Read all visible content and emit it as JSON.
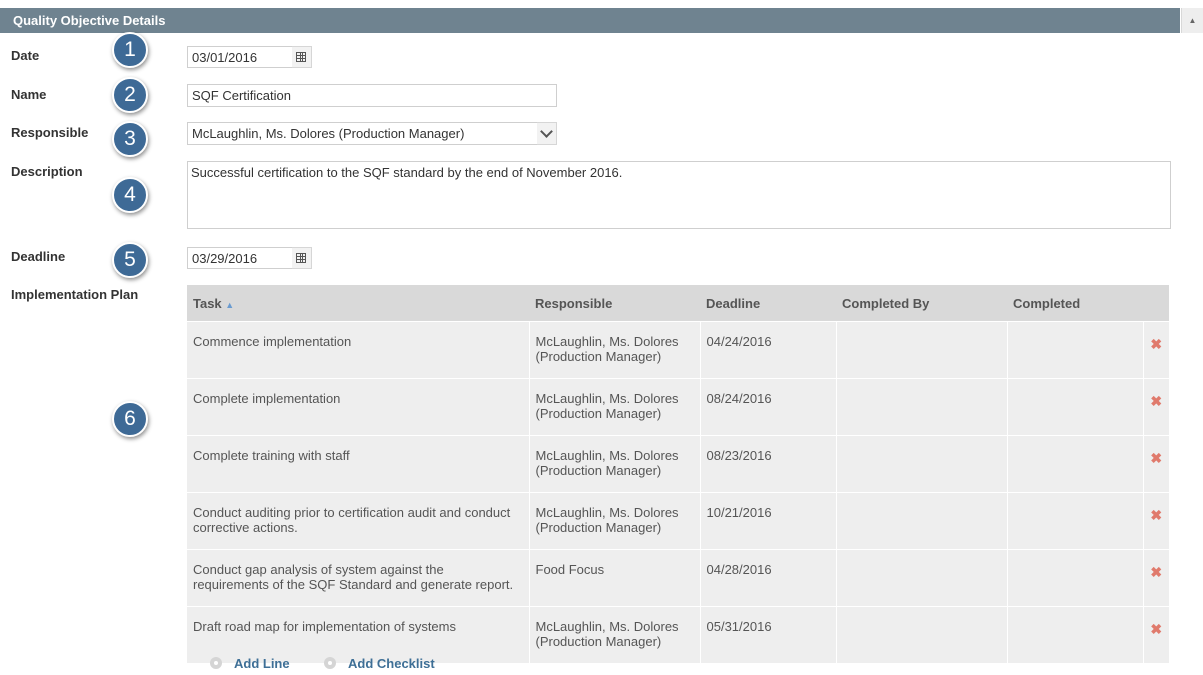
{
  "panel": {
    "title": "Quality Objective Details",
    "collapse_glyph": "▲"
  },
  "badges": [
    "1",
    "2",
    "3",
    "4",
    "5",
    "6"
  ],
  "form": {
    "date": {
      "label": "Date",
      "value": "03/01/2016"
    },
    "name": {
      "label": "Name",
      "value": "SQF Certification"
    },
    "responsible": {
      "label": "Responsible",
      "value": "McLaughlin, Ms. Dolores (Production Manager)"
    },
    "description": {
      "label": "Description",
      "value": "Successful certification to the SQF standard by the end of November 2016."
    },
    "deadline": {
      "label": "Deadline",
      "value": "03/29/2016"
    },
    "plan_label": "Implementation Plan"
  },
  "table": {
    "headers": [
      "Task",
      "Responsible",
      "Deadline",
      "Completed By",
      "Completed"
    ],
    "sort_glyph": "▲",
    "delete_glyph": "✖",
    "rows": [
      {
        "task": "Commence implementation",
        "responsible": "McLaughlin, Ms. Dolores (Production Manager)",
        "deadline": "04/24/2016",
        "completed_by": "",
        "completed": ""
      },
      {
        "task": "Complete implementation",
        "responsible": "McLaughlin, Ms. Dolores (Production Manager)",
        "deadline": "08/24/2016",
        "completed_by": "",
        "completed": ""
      },
      {
        "task": "Complete training with staff",
        "responsible": "McLaughlin, Ms. Dolores (Production Manager)",
        "deadline": "08/23/2016",
        "completed_by": "",
        "completed": ""
      },
      {
        "task": "Conduct auditing prior to certification audit and conduct corrective actions.",
        "responsible": "McLaughlin, Ms. Dolores (Production Manager)",
        "deadline": "10/21/2016",
        "completed_by": "",
        "completed": ""
      },
      {
        "task": "Conduct gap analysis of system against the requirements of the SQF Standard and generate report.",
        "responsible": "Food Focus",
        "deadline": "04/28/2016",
        "completed_by": "",
        "completed": ""
      },
      {
        "task": "Draft road map for implementation of systems",
        "responsible": "McLaughlin, Ms. Dolores (Production Manager)",
        "deadline": "05/31/2016",
        "completed_by": "",
        "completed": ""
      }
    ]
  },
  "actions": {
    "add_line": "Add Line",
    "add_checklist": "Add Checklist"
  },
  "colors": {
    "header_bg": "#6f8390",
    "badge": "#3e6a96",
    "link": "#3e6f96",
    "delete": "#e07a6c"
  }
}
